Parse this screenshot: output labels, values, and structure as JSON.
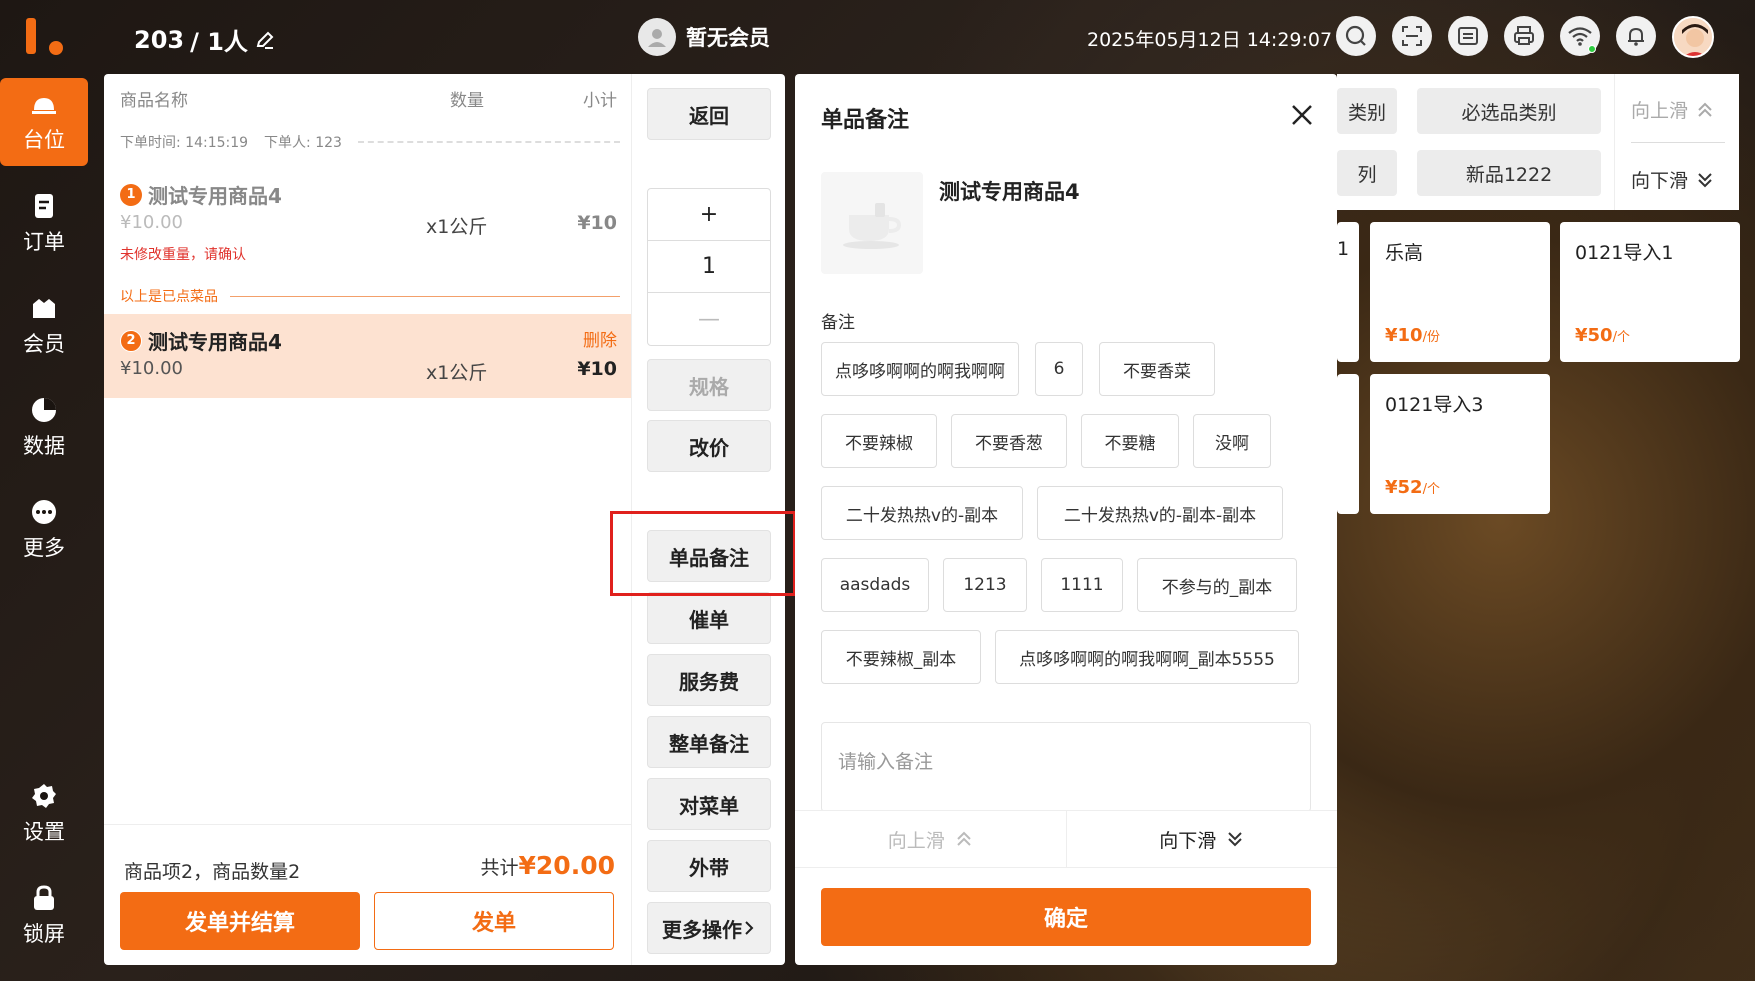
{
  "header": {
    "table": "203",
    "people": " / 1人",
    "member": "暂无会员",
    "datetime": "2025年05月12日 14:29:07"
  },
  "sidebar": {
    "items": [
      {
        "label": "台位",
        "icon": "table-bell-icon"
      },
      {
        "label": "订单",
        "icon": "order-icon"
      },
      {
        "label": "会员",
        "icon": "member-icon"
      },
      {
        "label": "数据",
        "icon": "pie-chart-icon"
      },
      {
        "label": "更多",
        "icon": "more-icon"
      },
      {
        "label": "设置",
        "icon": "gear-icon"
      },
      {
        "label": "锁屏",
        "icon": "lock-icon"
      }
    ]
  },
  "order": {
    "col_name": "商品名称",
    "col_qty": "数量",
    "col_sub": "小计",
    "order_time": "下单时间: 14:15:19",
    "order_user": "下单人: 123",
    "items": [
      {
        "idx": "1",
        "name": "测试专用商品4",
        "price": "¥10.00",
        "qty": "x1公斤",
        "subtotal": "¥10",
        "warning": "未修改重量，请确认"
      },
      {
        "idx": "2",
        "name": "测试专用商品4",
        "price": "¥10.00",
        "qty": "x1公斤",
        "subtotal": "¥10",
        "delete": "删除"
      }
    ],
    "ordered_divider": "以上是已点菜品",
    "summary": "商品项2，商品数量2",
    "total_label": "共计",
    "total": "¥20.00",
    "btn_settle": "发单并结算",
    "btn_send": "发单"
  },
  "actions": {
    "back": "返回",
    "plus": "+",
    "qty": "1",
    "minus": "—",
    "spec": "规格",
    "reprice": "改价",
    "item_note": "单品备注",
    "rush": "催单",
    "service_fee": "服务费",
    "order_note": "整单备注",
    "check_menu": "对菜单",
    "takeout": "外带",
    "more": "更多操作"
  },
  "modal": {
    "title": "单品备注",
    "product": "测试专用商品4",
    "note_label": "备注",
    "tags": [
      "点哆哆啊啊的啊我啊啊",
      "6",
      "不要香菜",
      "不要辣椒",
      "不要香葱",
      "不要糖",
      "没啊",
      "二十发热热v的-副本",
      "二十发热热v的-副本-副本",
      "aasdads",
      "1213",
      "1111",
      "不参与的_副本",
      "不要辣椒_副本",
      "点哆哆啊啊的啊我啊啊_副本5555"
    ],
    "input_placeholder": "请输入备注",
    "scroll_up": "向上滑",
    "scroll_down": "向下滑",
    "confirm": "确定"
  },
  "categories": {
    "row1_partial": "类别",
    "row1_b": "必选品类别",
    "row2_partial": "列",
    "row2_b": "新品1222",
    "scroll_up": "向上滑",
    "scroll_down": "向下滑"
  },
  "products": [
    {
      "name": "乐高",
      "price": "¥10",
      "unit": "/份"
    },
    {
      "name": "0121导入1",
      "price": "¥50",
      "unit": "/个"
    },
    {
      "name": "0121导入3",
      "price": "¥52",
      "unit": "/个"
    }
  ],
  "partial_card_text": "1",
  "colors": {
    "accent": "#f36c14",
    "highlight_row": "#fde2d1",
    "annotation_box": "#e0201c"
  }
}
